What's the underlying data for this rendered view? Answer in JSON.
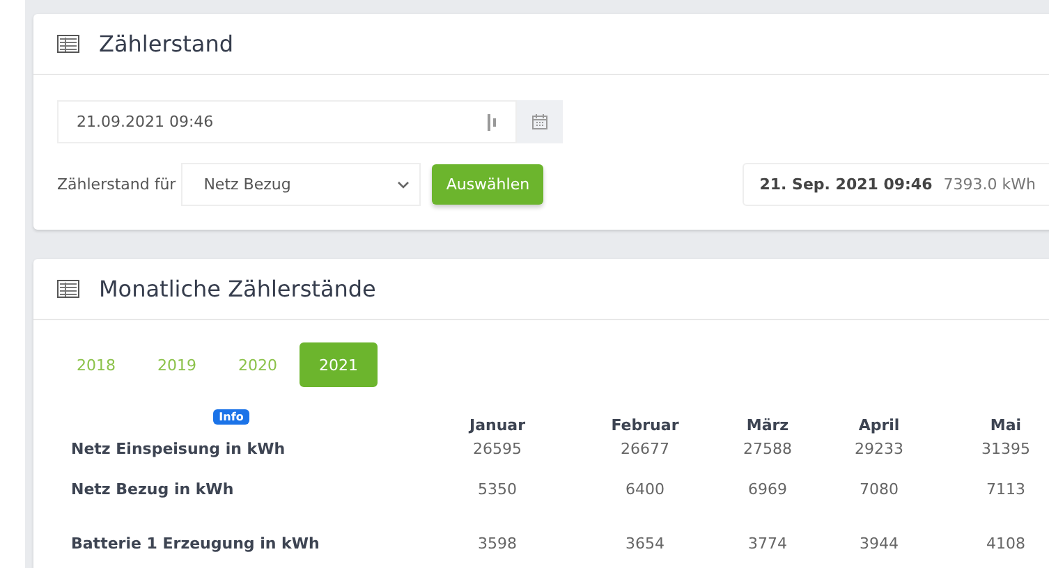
{
  "meter_card": {
    "title": "Zählerstand",
    "datetime_field": {
      "value": "21.09.2021 09:46"
    },
    "meter_label": "Zählerstand für",
    "meter_select": {
      "value": "Netz Bezug"
    },
    "select_button": "Auswählen",
    "result": {
      "date": "21. Sep. 2021 09:46",
      "value": "7393.0 kWh"
    }
  },
  "monthly_card": {
    "title": "Monatliche Zählerstände",
    "years": [
      {
        "label": "2018",
        "selected": false
      },
      {
        "label": "2019",
        "selected": false
      },
      {
        "label": "2020",
        "selected": false
      },
      {
        "label": "2021",
        "selected": true
      }
    ],
    "info_badge": "Info",
    "columns": [
      "Januar",
      "Februar",
      "März",
      "April",
      "Mai"
    ],
    "rows": [
      {
        "label": "Netz Einspeisung in kWh",
        "values": [
          "26595",
          "26677",
          "27588",
          "29233",
          "31395"
        ]
      },
      {
        "label": "Netz Bezug in kWh",
        "values": [
          "5350",
          "6400",
          "6969",
          "7080",
          "7113"
        ]
      },
      {
        "label": "Batterie 1 Erzeugung in kWh",
        "values": [
          "3598",
          "3654",
          "3774",
          "3944",
          "4108"
        ]
      }
    ]
  }
}
